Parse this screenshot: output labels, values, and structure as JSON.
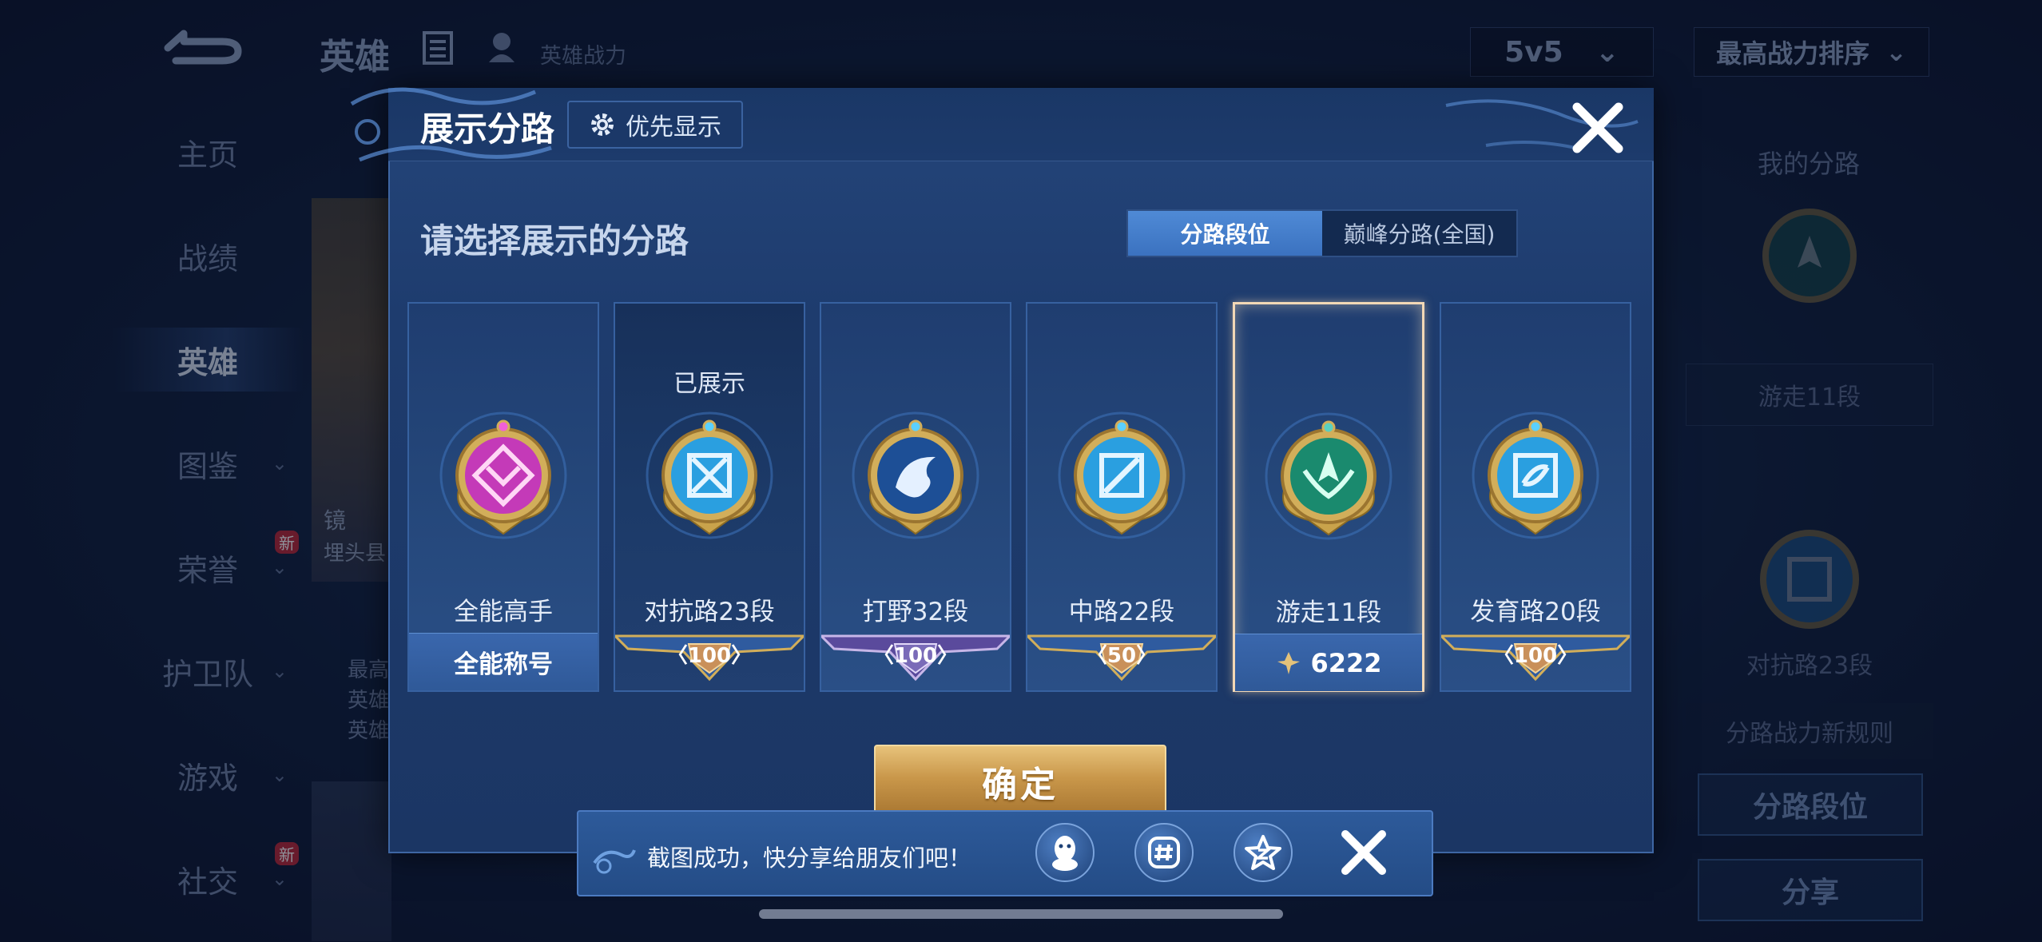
{
  "topbar": {
    "title": "英雄",
    "power_label": "英雄战力",
    "mode": "5v5",
    "sort": "最高战力排序"
  },
  "sidebar": {
    "items": [
      {
        "label": "主页"
      },
      {
        "label": "战绩"
      },
      {
        "label": "英雄"
      },
      {
        "label": "图鉴"
      },
      {
        "label": "荣誉",
        "badge": "新"
      },
      {
        "label": "护卫队"
      },
      {
        "label": "游戏"
      },
      {
        "label": "社交",
        "badge": "新"
      }
    ]
  },
  "hero": {
    "name": "镜",
    "subtitle": "埋头县",
    "stats": [
      "最高",
      "英雄",
      "英雄"
    ]
  },
  "right_panel": {
    "title": "我的分路",
    "lane1": "游走11段",
    "lane2": "对抗路23段",
    "rule": "分路战力新规则",
    "btn_lane": "分路段位",
    "btn_share": "分享"
  },
  "modal": {
    "title": "展示分路",
    "priority_label": "优先显示",
    "subtitle": "请选择展示的分路",
    "tabs": [
      "分路段位",
      "巅峰分路(全国)"
    ],
    "active_tab": 0,
    "confirm": "确定",
    "cards": [
      {
        "name": "全能高手",
        "bottom": "全能称号",
        "color": "#c43ab8"
      },
      {
        "name": "对抗路23段",
        "bottom": "100",
        "shown": "已展示",
        "color": "#2a9fe0"
      },
      {
        "name": "打野32段",
        "bottom": "100",
        "color": "#2a7ad0",
        "purple": true
      },
      {
        "name": "中路22段",
        "bottom": "50",
        "color": "#2a9fe0"
      },
      {
        "name": "游走11段",
        "bottom": "6222",
        "color": "#1a8a6e",
        "selected": true
      },
      {
        "name": "发育路20段",
        "bottom": "100",
        "color": "#2a9fe0"
      }
    ]
  },
  "share": {
    "text": "截图成功，快分享给朋友们吧！",
    "icons": [
      "qq-icon",
      "wechat-icon",
      "qzone-icon"
    ]
  }
}
